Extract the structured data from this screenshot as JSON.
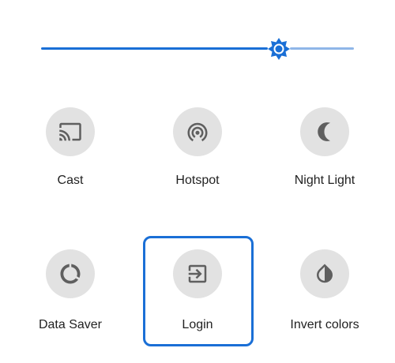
{
  "brightness": {
    "level": 0.76,
    "colors": {
      "active": "#1a6fd6",
      "inactive": "#8fb6e8"
    },
    "thumb_icon": "brightness-sun-icon"
  },
  "tiles": [
    {
      "label": "Cast",
      "icon": "cast-icon"
    },
    {
      "label": "Hotspot",
      "icon": "hotspot-icon"
    },
    {
      "label": "Night Light",
      "icon": "night-light-moon-icon"
    },
    {
      "label": "Data Saver",
      "icon": "data-saver-icon"
    },
    {
      "label": "Login",
      "icon": "login-icon",
      "focused": true
    },
    {
      "label": "Invert colors",
      "icon": "invert-colors-icon"
    }
  ],
  "colors": {
    "tile_background": "#e2e2e2",
    "icon": "#5f5f5f",
    "focus": "#1a6fd6",
    "label": "#222222"
  }
}
